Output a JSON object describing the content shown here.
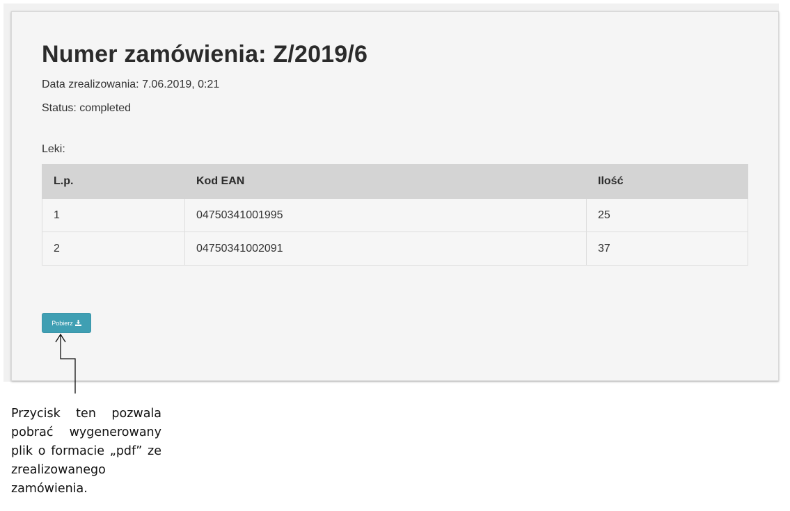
{
  "order": {
    "title": "Numer zamówienia: Z/2019/6",
    "date_line": "Data zrealizowania: 7.06.2019, 0:21",
    "status_line": "Status: completed",
    "items_label": "Leki:"
  },
  "table": {
    "headers": [
      "L.p.",
      "Kod EAN",
      "Ilość"
    ],
    "rows": [
      [
        "1",
        "04750341001995",
        "25"
      ],
      [
        "2",
        "04750341002091",
        "37"
      ]
    ]
  },
  "download": {
    "label": "Pobierz",
    "icon": "download-icon",
    "color": "#3f9fb3"
  },
  "annotation": {
    "text": "Przycisk ten pozwala pobrać wygenerowany plik o formacie „pdf” ze zrealizowanego zamówienia."
  }
}
